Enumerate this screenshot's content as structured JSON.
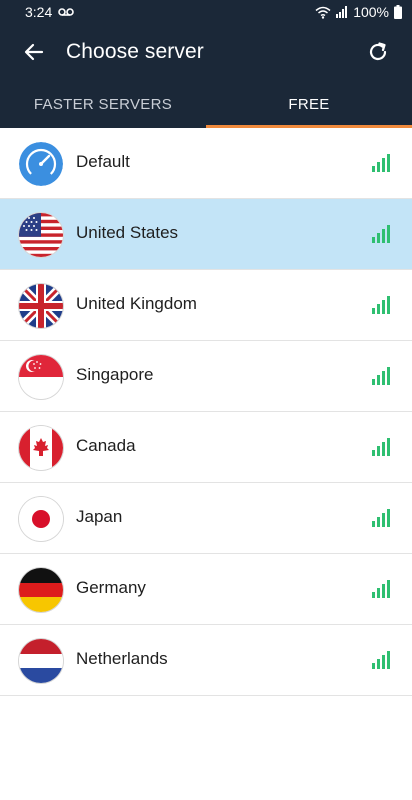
{
  "status_bar": {
    "time": "3:24",
    "battery": "100%",
    "icons": [
      "voicemail-icon",
      "wifi-icon",
      "cell-signal-icon",
      "battery-icon"
    ]
  },
  "app_bar": {
    "title": "Choose server",
    "back_icon": "arrow-left-icon",
    "refresh_icon": "refresh-icon"
  },
  "tabs": [
    {
      "label": "FASTER SERVERS",
      "active": false
    },
    {
      "label": "FREE",
      "active": true
    }
  ],
  "colors": {
    "header_bg": "#1b2838",
    "tab_indicator": "#f08a3c",
    "selected_row": "#c3e4f7",
    "signal_green": "#2fbf71"
  },
  "servers": [
    {
      "name": "Default",
      "icon": "speedometer-icon",
      "selected": false
    },
    {
      "name": "United States",
      "icon": "us-flag-icon",
      "selected": true
    },
    {
      "name": "United Kingdom",
      "icon": "uk-flag-icon",
      "selected": false
    },
    {
      "name": "Singapore",
      "icon": "singapore-flag-icon",
      "selected": false
    },
    {
      "name": "Canada",
      "icon": "canada-flag-icon",
      "selected": false
    },
    {
      "name": "Japan",
      "icon": "japan-flag-icon",
      "selected": false
    },
    {
      "name": "Germany",
      "icon": "germany-flag-icon",
      "selected": false
    },
    {
      "name": "Netherlands",
      "icon": "netherlands-flag-icon",
      "selected": false
    }
  ]
}
